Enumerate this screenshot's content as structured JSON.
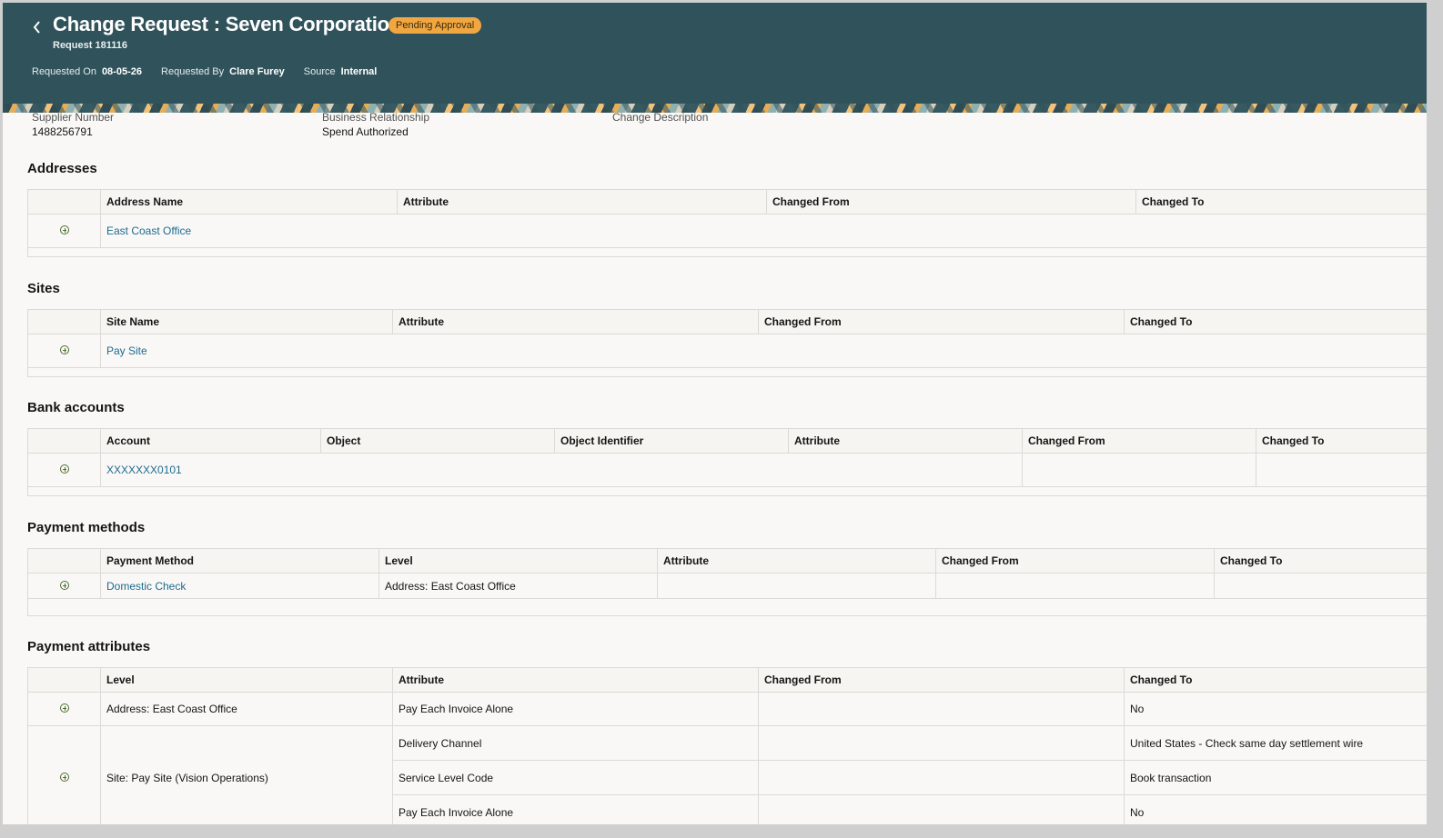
{
  "header": {
    "title": "Change Request : Seven Corporation",
    "status_badge": "Pending Approval",
    "subtitle": "Request 181116",
    "requested_on_label": "Requested On",
    "requested_on_value": "08-05-26",
    "requested_by_label": "Requested By",
    "requested_by_value": "Clare Furey",
    "source_label": "Source",
    "source_value": "Internal"
  },
  "summary": {
    "supplier_number_label": "Supplier Number",
    "supplier_number_value": "1488256791",
    "business_relationship_label": "Business Relationship",
    "business_relationship_value": "Spend Authorized",
    "change_description_label": "Change Description"
  },
  "addresses": {
    "title": "Addresses",
    "columns": [
      "Address Name",
      "Attribute",
      "Changed From",
      "Changed To"
    ],
    "rows": [
      {
        "name": "East Coast Office"
      }
    ]
  },
  "sites": {
    "title": "Sites",
    "columns": [
      "Site Name",
      "Attribute",
      "Changed From",
      "Changed To"
    ],
    "rows": [
      {
        "name": "Pay Site"
      }
    ]
  },
  "bank_accounts": {
    "title": "Bank accounts",
    "columns": [
      "Account",
      "Object",
      "Object Identifier",
      "Attribute",
      "Changed From",
      "Changed To"
    ],
    "rows": [
      {
        "account": "XXXXXXX0101"
      }
    ]
  },
  "payment_methods": {
    "title": "Payment methods",
    "columns": [
      "Payment Method",
      "Level",
      "Attribute",
      "Changed From",
      "Changed To"
    ],
    "rows": [
      {
        "method": "Domestic Check",
        "level": "Address: East Coast Office"
      }
    ]
  },
  "payment_attributes": {
    "title": "Payment attributes",
    "columns": [
      "Level",
      "Attribute",
      "Changed From",
      "Changed To"
    ],
    "rows": [
      {
        "level": "Address: East Coast Office",
        "attribute": "Pay Each Invoice Alone",
        "changed_to": "No"
      },
      {
        "level": "Site: Pay Site (Vision Operations)",
        "attribute": "Delivery Channel",
        "changed_to": "United States - Check same day settlement wire"
      },
      {
        "attribute": "Service Level Code",
        "changed_to": "Book transaction"
      },
      {
        "attribute": "Pay Each Invoice Alone",
        "changed_to": "No"
      }
    ]
  },
  "colors": {
    "header_bg": "#30535b",
    "badge_bg": "#f0a742",
    "link": "#1e6b8f",
    "page_bg": "#f9f8f6"
  },
  "icons": [
    "back-chevron-icon",
    "expand-icon"
  ]
}
